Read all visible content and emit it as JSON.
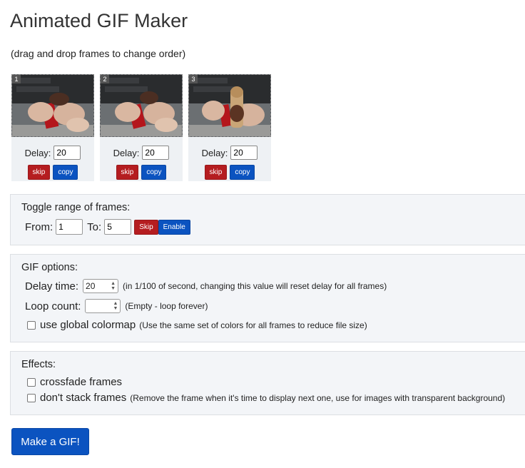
{
  "page": {
    "title": "Animated GIF Maker",
    "subtitle": "(drag and drop frames to change order)"
  },
  "frames": [
    {
      "number": "1",
      "delay_label": "Delay:",
      "delay_value": "20",
      "skip_label": "skip",
      "copy_label": "copy",
      "image": "chocolate-bar-photo"
    },
    {
      "number": "2",
      "delay_label": "Delay:",
      "delay_value": "20",
      "skip_label": "skip",
      "copy_label": "copy",
      "image": "chocolate-bar-photo"
    },
    {
      "number": "3",
      "delay_label": "Delay:",
      "delay_value": "20",
      "skip_label": "skip",
      "copy_label": "copy",
      "image": "chocolate-bar-photo"
    }
  ],
  "toggle_range": {
    "title": "Toggle range of frames:",
    "from_label": "From:",
    "from_value": "1",
    "to_label": "To:",
    "to_value": "5",
    "skip_label": "Skip",
    "enable_label": "Enable"
  },
  "gif_options": {
    "title": "GIF options:",
    "delay_label": "Delay time:",
    "delay_value": "20",
    "delay_note": "(in 1/100 of second, changing this value will reset delay for all frames)",
    "loop_label": "Loop count:",
    "loop_value": "",
    "loop_note": "(Empty - loop forever)",
    "colormap_label": "use global colormap",
    "colormap_checked": false,
    "colormap_note": "(Use the same set of colors for all frames to reduce file size)"
  },
  "effects": {
    "title": "Effects:",
    "crossfade_label": "crossfade frames",
    "crossfade_checked": false,
    "nostack_label": "don't stack frames",
    "nostack_checked": false,
    "nostack_note": "(Remove the frame when it's time to display next one, use for images with transparent background)"
  },
  "make_button": "Make a GIF!",
  "colors": {
    "skip": "#b51d20",
    "copy": "#0b53c0",
    "panel": "#f3f5f8"
  }
}
